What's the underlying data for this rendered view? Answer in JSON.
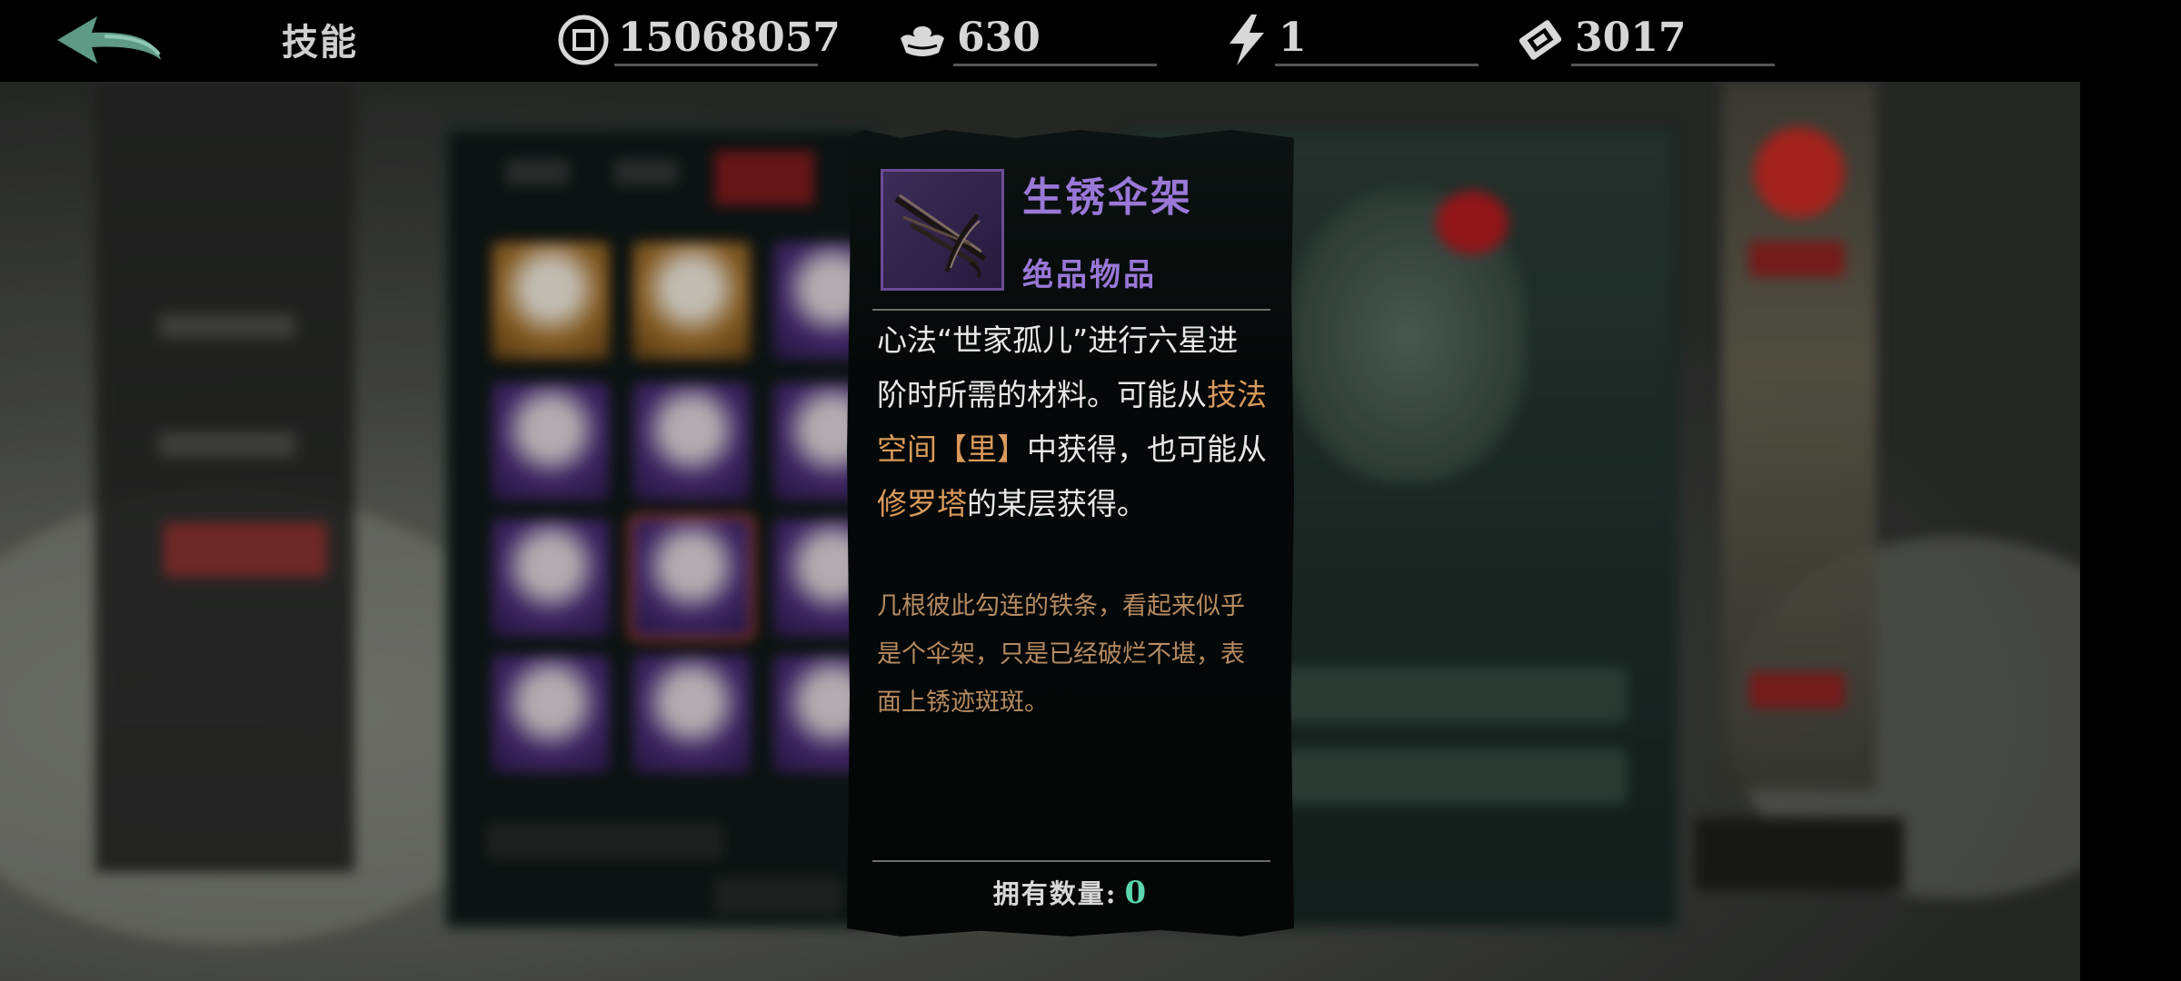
{
  "topbar": {
    "title": "技能",
    "currencies": [
      {
        "icon": "copper-coin-icon",
        "value": "15068057"
      },
      {
        "icon": "silver-ingot-icon",
        "value": "630"
      },
      {
        "icon": "lightning-energy-icon",
        "value": "1"
      },
      {
        "icon": "ticket-scroll-icon",
        "value": "3017"
      }
    ]
  },
  "tooltip": {
    "item_name": "生锈伞架",
    "item_grade": "绝品物品",
    "description": {
      "p1": "心法“世家孤儿”进行六星进阶时所需的材料。可能从",
      "hl1": "技法空间【里】",
      "p2": "中获得，也可能从",
      "hl2": "修罗塔",
      "p3": "的某层获得。"
    },
    "flavor_text": "几根彼此勾连的铁条，看起来似乎是个伞架，只是已经破烂不堪，表面上锈迹斑斑。",
    "owned_label": "拥有数量:",
    "owned_count": "0"
  },
  "colors": {
    "item_purple": "#9a78d8",
    "highlight_orange": "#d99a5a",
    "flavor_brown": "#b58b62",
    "count_green": "#5bd6ae"
  }
}
